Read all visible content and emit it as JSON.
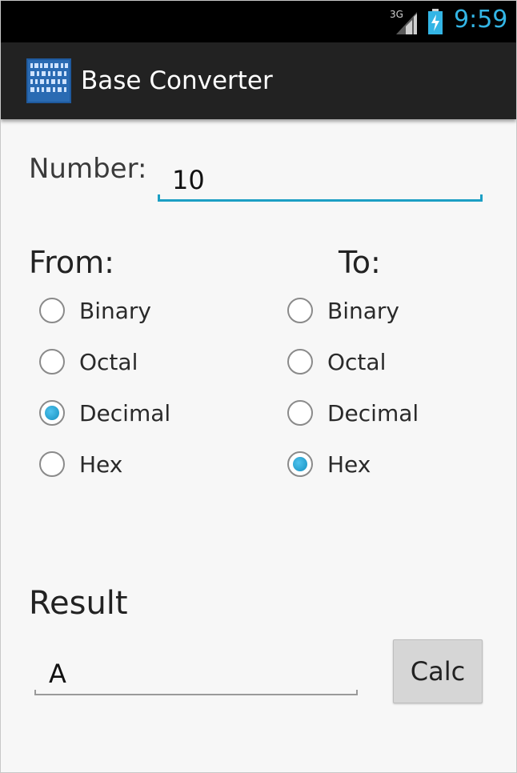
{
  "status_bar": {
    "network": "3G",
    "time": "9:59",
    "signal_icon": "signal-icon",
    "battery_icon": "battery-charging-icon",
    "time_color": "#33b5e5"
  },
  "action_bar": {
    "title": "Base Converter",
    "icon": "binary-app-icon"
  },
  "form": {
    "number_label": "Number:",
    "number_value": "10",
    "from_label": "From:",
    "to_label": "To:",
    "from_options": [
      "Binary",
      "Octal",
      "Decimal",
      "Hex"
    ],
    "from_selected": "Decimal",
    "to_options": [
      "Binary",
      "Octal",
      "Decimal",
      "Hex"
    ],
    "to_selected": "Hex",
    "result_label": "Result",
    "result_value": "A",
    "calc_label": "Calc",
    "accent_color": "#1c9fc4"
  }
}
